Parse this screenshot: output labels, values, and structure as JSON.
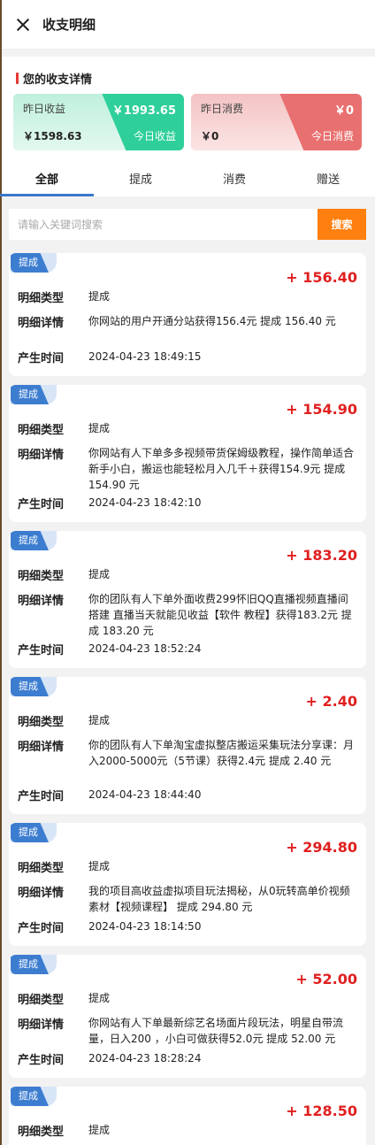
{
  "header": {
    "title": "收支明细"
  },
  "summary": {
    "section_title": "您的收支详情",
    "income": {
      "label": "昨日收益",
      "yesterday": "￥1993.65",
      "today": "￥1598.63",
      "today_label": "今日收益"
    },
    "expense": {
      "label": "昨日消费",
      "yesterday": "￥0",
      "today": "￥0",
      "today_label": "今日消费"
    }
  },
  "tabs": [
    "全部",
    "提成",
    "消费",
    "赠送"
  ],
  "active_tab": "全部",
  "search": {
    "placeholder": "请输入关键词搜索",
    "button": "搜索"
  },
  "labels": {
    "type": "明细类型",
    "detail": "明细详情",
    "time": "产生时间"
  },
  "records": [
    {
      "badge": "提成",
      "amount": "+ 156.40",
      "type": "提成",
      "detail": "你网站的用户开通分站获得156.4元 提成 156.40 元",
      "time": "2024-04-23 18:49:15"
    },
    {
      "badge": "提成",
      "amount": "+ 154.90",
      "type": "提成",
      "detail": "你网站有人下单多多视频带货保姆级教程，操作简单适合新手小白，搬运也能轻松月入几千＋获得154.9元 提成 154.90 元",
      "time": "2024-04-23 18:42:10"
    },
    {
      "badge": "提成",
      "amount": "+ 183.20",
      "type": "提成",
      "detail": "你的团队有人下单外面收费299怀旧QQ直播视频直播间搭建 直播当天就能见收益【软件 教程】获得183.2元 提成 183.20 元",
      "time": "2024-04-23 18:52:24"
    },
    {
      "badge": "提成",
      "amount": "+ 2.40",
      "type": "提成",
      "detail": "你的团队有人下单淘宝虚拟整店搬运采集玩法分享课：月入2000-5000元（5节课）获得2.4元 提成 2.40 元",
      "time": "2024-04-23 18:44:40"
    },
    {
      "badge": "提成",
      "amount": "+ 294.80",
      "type": "提成",
      "detail": "我的项目高收益虚拟项目玩法揭秘，从0玩转高单价视频素材【视频课程】 提成 294.80 元",
      "time": "2024-04-23 18:14:50"
    },
    {
      "badge": "提成",
      "amount": "+ 52.00",
      "type": "提成",
      "detail": "你网站有人下单最新综艺名场面片段玩法，明星自带流量，日入200 ，小白可做获得52.0元 提成 52.00 元",
      "time": "2024-04-23 18:28:24"
    },
    {
      "badge": "提成",
      "amount": "+ 128.50",
      "type": "提成",
      "detail": "",
      "time": ""
    }
  ]
}
